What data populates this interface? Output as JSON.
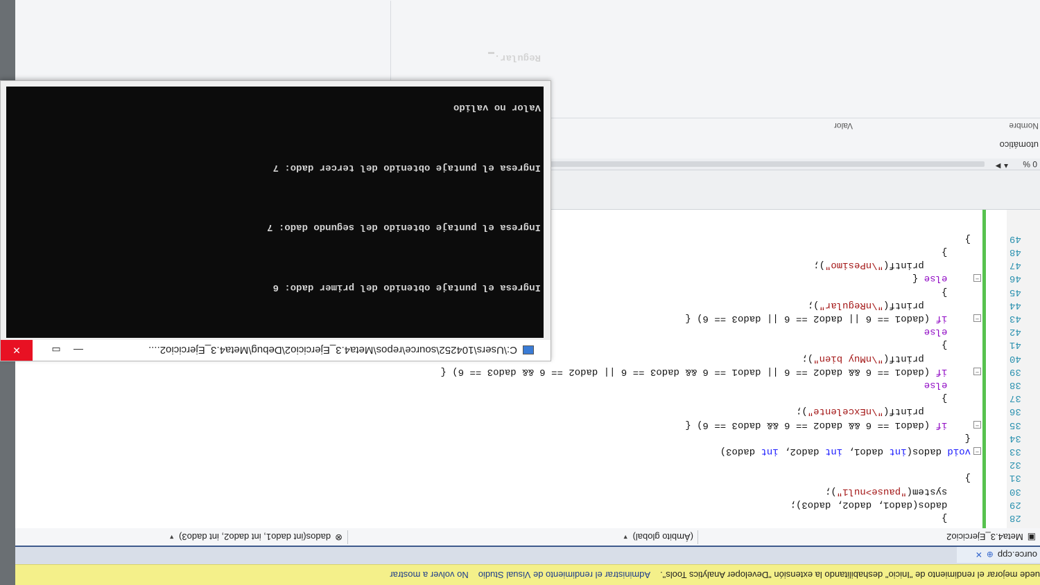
{
  "infobar": {
    "message": "uede mejorar el rendimiento de \"Inicio\" deshabilitando la extensión \"Developer Analytics Tools\".",
    "link_manage": "Administrar el rendimiento de Visual Studio",
    "link_dismiss": "No volver a mostrar"
  },
  "tab": {
    "label": "ource.cpp",
    "pin": "⊕",
    "close": "✕"
  },
  "navbar": {
    "project": "Meta4.3_Ejercicio2",
    "scope": "(Ámbito global)",
    "function": "dados(int dado1, int dado2, int dado3)"
  },
  "code": [
    {
      "num": "28",
      "text": "    }"
    },
    {
      "num": "29",
      "text": "    dados(dado1, dado2, dado3);"
    },
    {
      "num": "30",
      "text": "    system(\"pause>nul1\");"
    },
    {
      "num": "31",
      "text": "}"
    },
    {
      "num": "32",
      "text": ""
    },
    {
      "num": "33",
      "text": "void dados(int dado1, int dado2, int dado3)"
    },
    {
      "num": "34",
      "text": "{"
    },
    {
      "num": "35",
      "text": "    if (dado1 == 6 && dado2 == 6 && dado3 == 6) {"
    },
    {
      "num": "36",
      "text": "        printf(\"\\nExcelente\");"
    },
    {
      "num": "37",
      "text": "    }"
    },
    {
      "num": "38",
      "text": "    else"
    },
    {
      "num": "39",
      "text": "    if (dado1 == 6 && dado2 == 6 || dado1 == 6 && dado3 == 6 || dado2 == 6 && dado3 == 6) {"
    },
    {
      "num": "40",
      "text": "        printf(\"\\nMuy bien\");"
    },
    {
      "num": "41",
      "text": "    }"
    },
    {
      "num": "42",
      "text": "    else"
    },
    {
      "num": "43",
      "text": "    if (dado1 == 6 || dado2 == 6 || dado3 == 6) {"
    },
    {
      "num": "44",
      "text": "        printf(\"\\nRegular\");"
    },
    {
      "num": "45",
      "text": "    }"
    },
    {
      "num": "46",
      "text": "    else {"
    },
    {
      "num": "47",
      "text": "        printf(\"\\nPesimo\");"
    },
    {
      "num": "48",
      "text": "    }"
    },
    {
      "num": "49",
      "text": "}"
    }
  ],
  "zoom": "0 %",
  "autos": {
    "title": "utomático",
    "col_name": "Nombre",
    "col_value": "Valor"
  },
  "console": {
    "title": "C:\\Users\\104252\\source\\repos\\Meta4.3_Ejercicio2\\Debug\\Meta4.3_Ejercicio2....",
    "lines": [
      "Ingresa el puntaje obtenido del primer dado: 6",
      "Ingresa el puntaje obtenido del segundo dado: 7",
      "Ingresa el puntaje obtenido del tercer dado: 7",
      "Valor no valido",
      "Regular."
    ]
  }
}
